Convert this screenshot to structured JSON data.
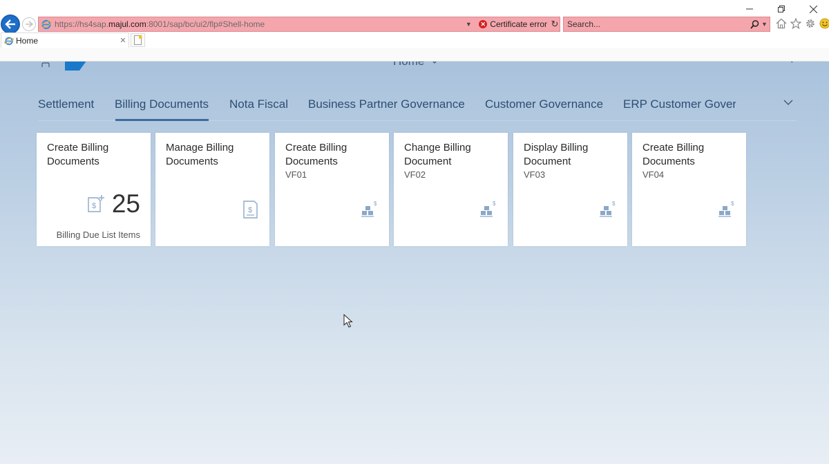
{
  "browser": {
    "url_prefix": "https://hs4sap.",
    "url_host": "majul.com",
    "url_suffix": ":8001/sap/bc/ui2/flp#Shell-home",
    "certificate_error": "Certificate error",
    "search_placeholder": "Search...",
    "tab_title": "Home"
  },
  "shell": {
    "title": "Home"
  },
  "anchor_bar": {
    "items": [
      "Settlement",
      "Billing Documents",
      "Nota Fiscal",
      "Business Partner Governance",
      "Customer Governance",
      "ERP Customer Gover"
    ],
    "selected_index": 1
  },
  "tiles": [
    {
      "title": "Create Billing Documents",
      "subtitle": "",
      "kpi_value": "25",
      "footer": "Billing Due List Items",
      "icon": "billing-document-add-icon"
    },
    {
      "title": "Manage Billing Documents",
      "subtitle": "",
      "kpi_value": "",
      "footer": "",
      "icon": "billing-document-icon"
    },
    {
      "title": "Create Billing Documents",
      "subtitle": "VF01",
      "kpi_value": "",
      "footer": "",
      "icon": "gui-transaction-icon"
    },
    {
      "title": "Change Billing Document",
      "subtitle": "VF02",
      "kpi_value": "",
      "footer": "",
      "icon": "gui-transaction-icon"
    },
    {
      "title": "Display Billing Document",
      "subtitle": "VF03",
      "kpi_value": "",
      "footer": "",
      "icon": "gui-transaction-icon"
    },
    {
      "title": "Create Billing Documents",
      "subtitle": "VF04",
      "kpi_value": "",
      "footer": "",
      "icon": "gui-transaction-icon"
    }
  ],
  "colors": {
    "accent": "#3d6c9e",
    "address_error_bg": "#f5a6ad",
    "tile_icon": "#8aa8c8"
  }
}
